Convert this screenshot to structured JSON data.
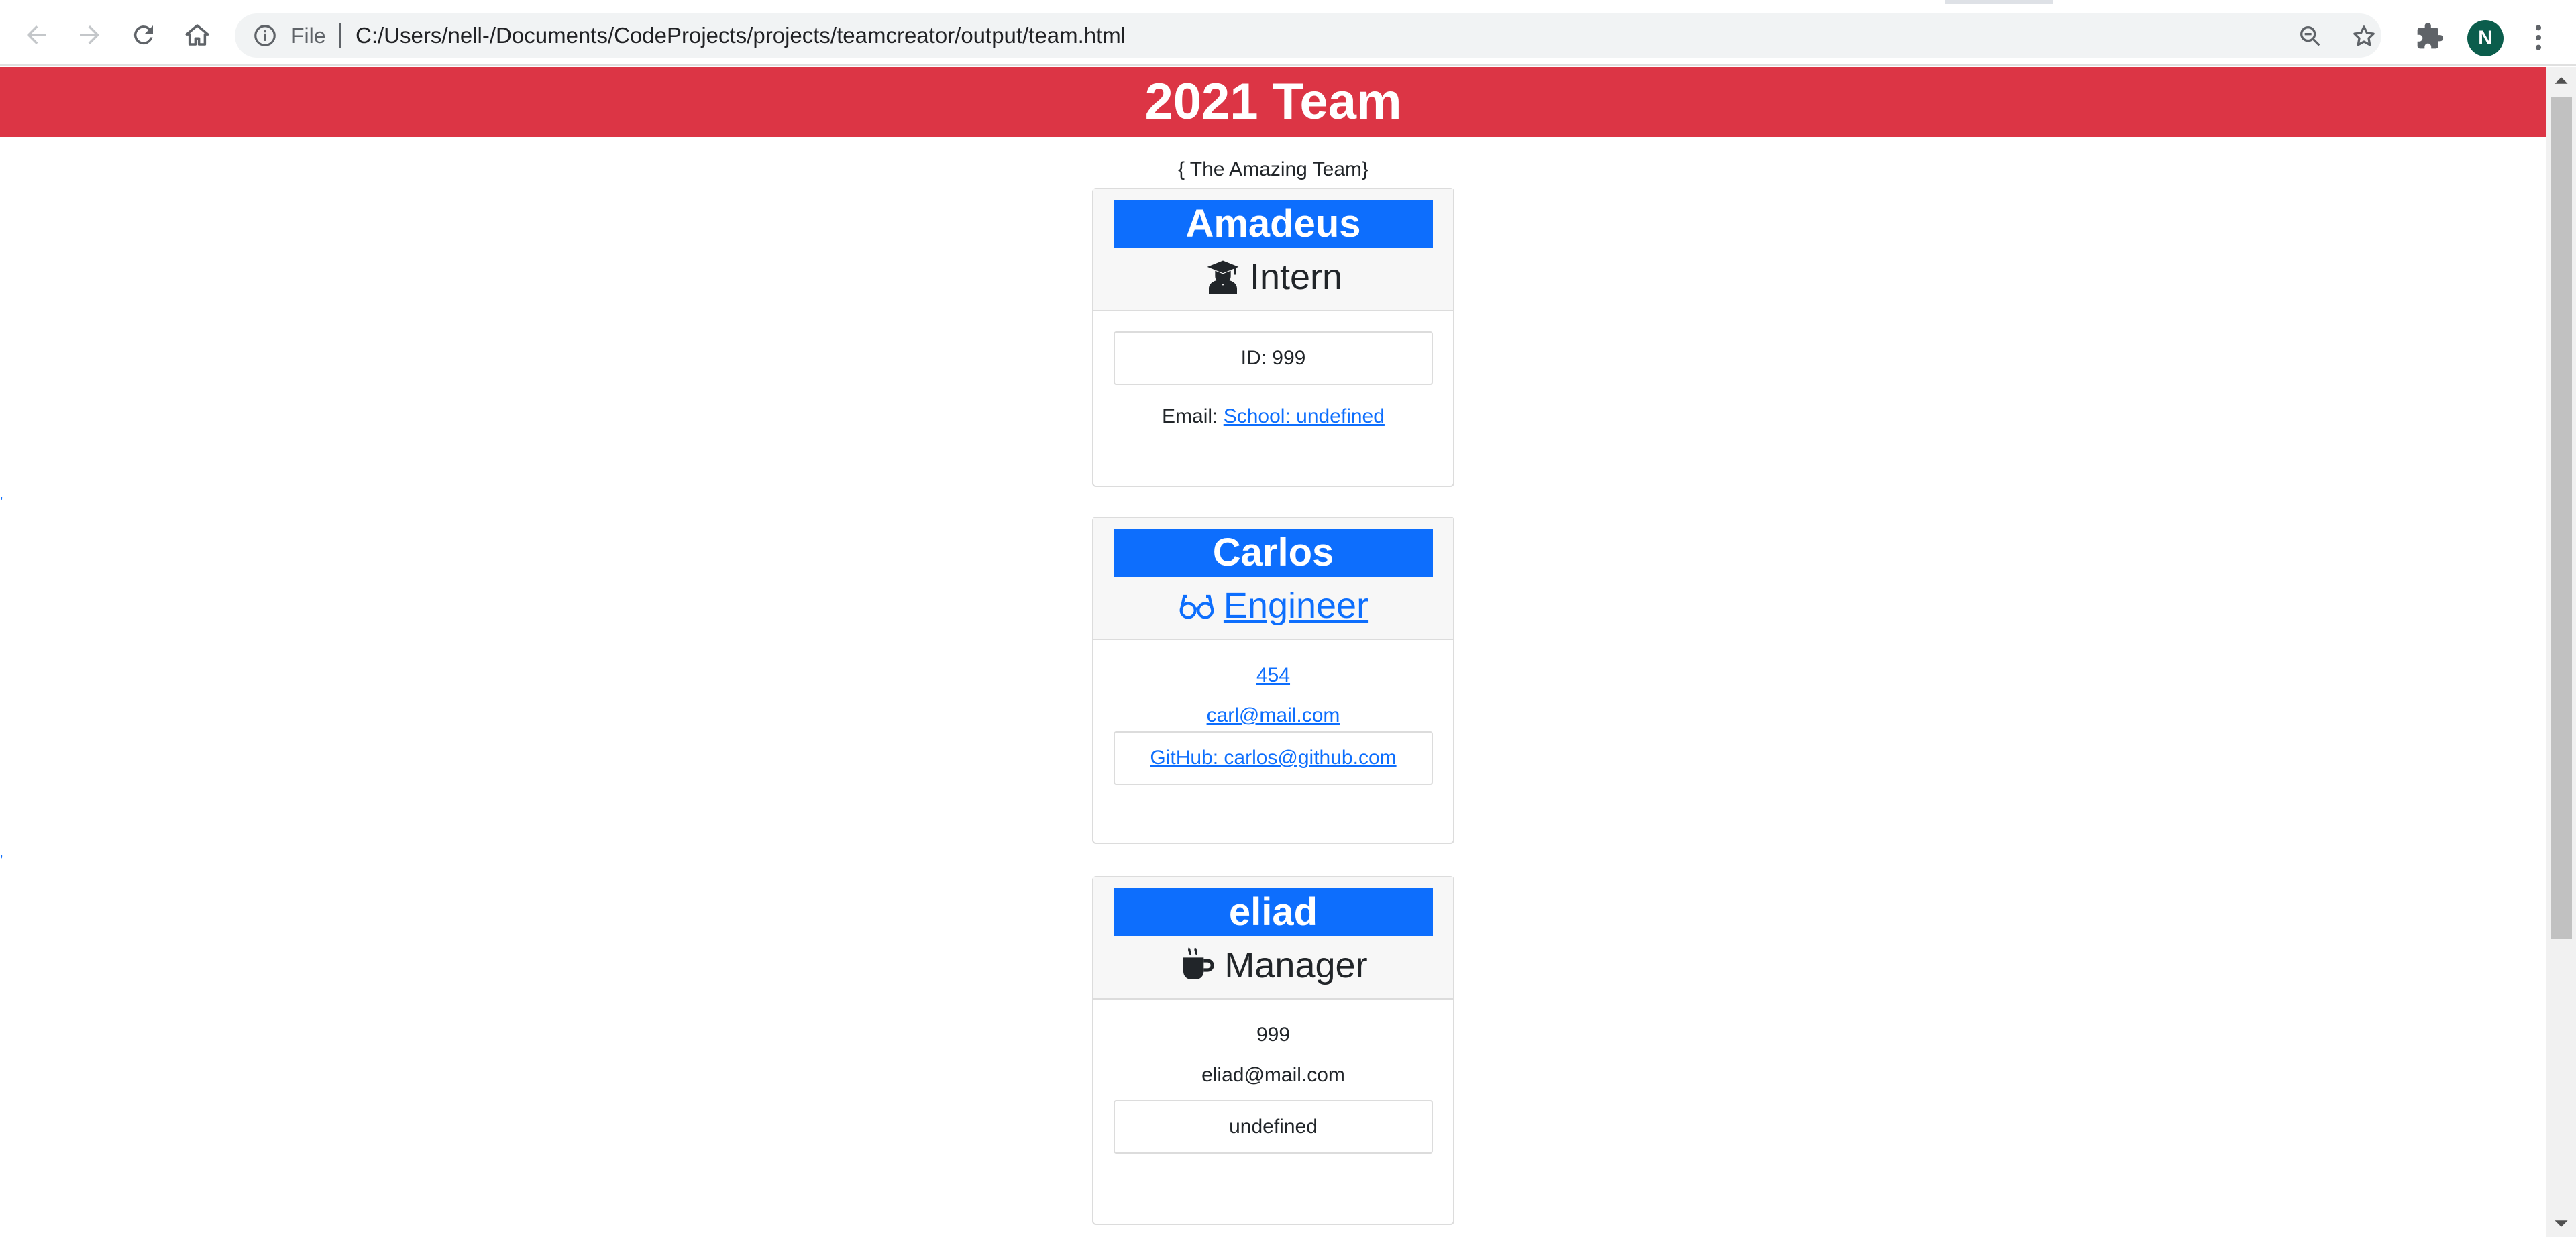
{
  "browser": {
    "file_label": "File",
    "url": "C:/Users/nell-/Documents/CodeProjects/projects/teamcreator/output/team.html",
    "profile_initial": "N"
  },
  "page": {
    "title": "2021 Team",
    "subtitle": "{ The Amazing Team}"
  },
  "team": [
    {
      "name": "Amadeus",
      "role": "Intern",
      "role_icon": "graduate-icon",
      "id_text": "ID: 999",
      "email_label": "Email: ",
      "email_link": "School: undefined"
    },
    {
      "name": "Carlos",
      "role": "Engineer",
      "role_icon": "glasses-icon",
      "id_text": "454",
      "email": "carl@mail.com",
      "github": "GitHub: carlos@github.com"
    },
    {
      "name": "eliad",
      "role": "Manager",
      "role_icon": "mug-icon",
      "id_text": "999",
      "email": "eliad@mail.com",
      "office": "undefined"
    }
  ],
  "colors": {
    "header_bg": "#dc3545",
    "name_bar_bg": "#0d6efd",
    "link": "#0d6efd",
    "avatar_bg": "#0b5d4c"
  }
}
